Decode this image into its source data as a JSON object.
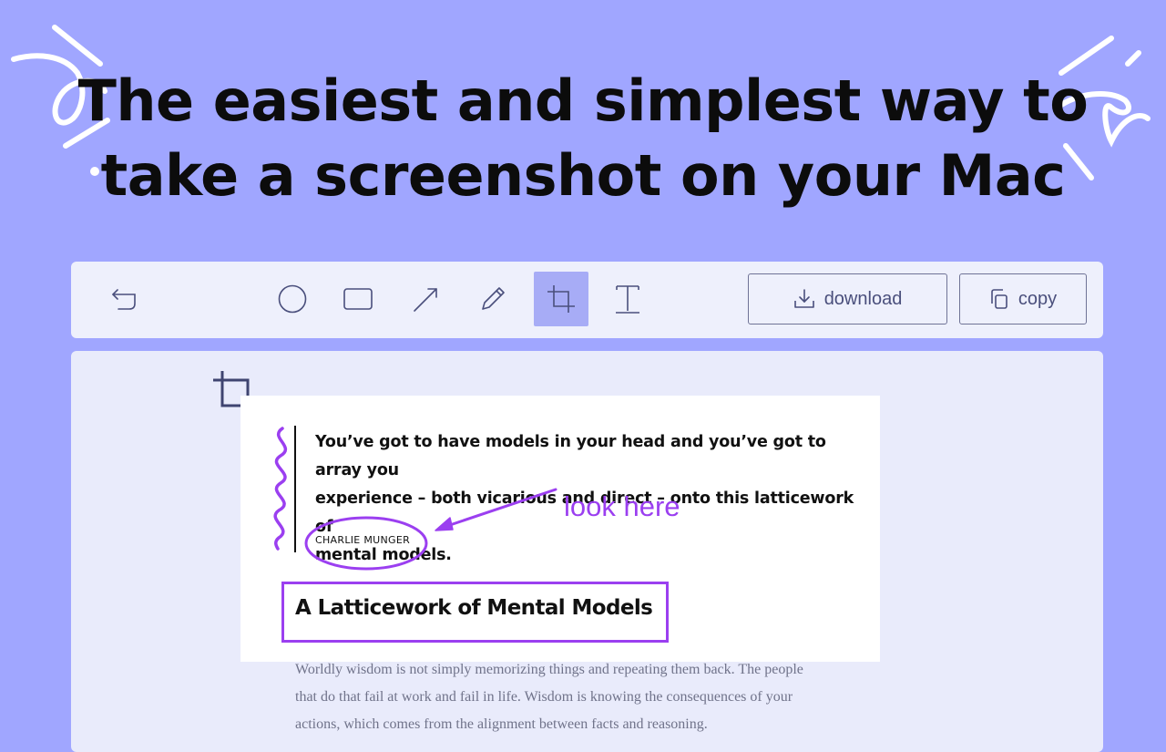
{
  "headline": {
    "line1": "The easiest and simplest way to",
    "line2": "take a screenshot on your Mac"
  },
  "toolbar": {
    "tools": [
      {
        "name": "undo",
        "icon": "undo-icon"
      },
      {
        "name": "circle",
        "icon": "circle-icon"
      },
      {
        "name": "rectangle",
        "icon": "rectangle-icon"
      },
      {
        "name": "arrow",
        "icon": "arrow-icon"
      },
      {
        "name": "pencil",
        "icon": "pencil-icon"
      },
      {
        "name": "crop",
        "icon": "crop-icon",
        "active": true
      },
      {
        "name": "text",
        "icon": "text-icon"
      }
    ],
    "download_label": "download",
    "copy_label": "copy"
  },
  "document": {
    "quote_lines": [
      "You’ve got to have models in your head and you’ve got to array you",
      "experience – both vicarious and direct – onto this latticework of",
      "mental models."
    ],
    "author": "CHARLIE MUNGER",
    "section_title": "A Latticework of Mental Models",
    "body_lines": [
      "Worldly wisdom is not simply memorizing things and repeating them back. The people",
      "that do that fail at work and fail in life. Wisdom is knowing the consequences of your",
      "actions, which comes from the alignment between facts and reasoning."
    ]
  },
  "annotations": {
    "note": "look here",
    "color": "#9b3ff0"
  },
  "colors": {
    "background": "#a0a6ff",
    "toolbar": "#eef0fc",
    "canvas": "#e9ebfb",
    "active_tool": "#a7acf6",
    "icon": "#4a4f7c",
    "annotation": "#9b3ff0"
  }
}
